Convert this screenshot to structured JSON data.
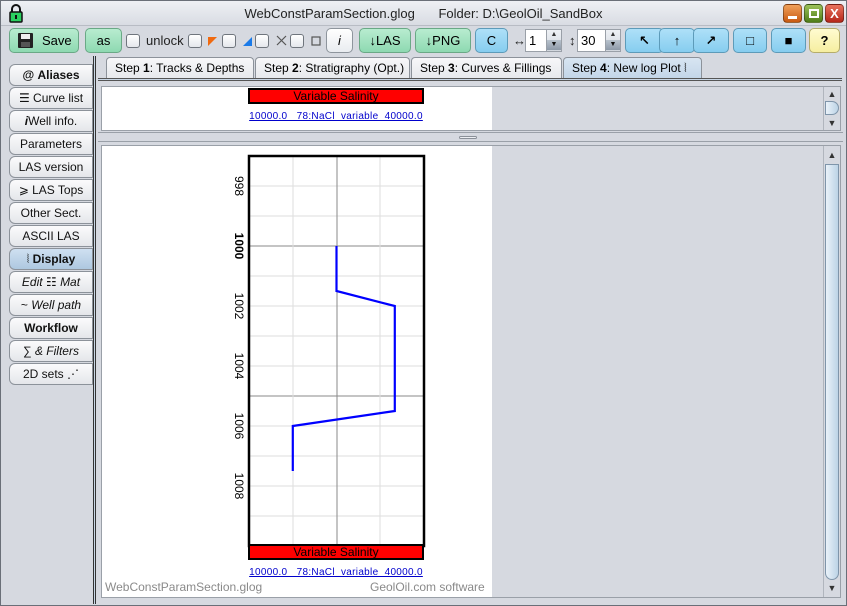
{
  "window": {
    "title": "WebConstParamSection.glog",
    "folder": "Folder: D:\\GeolOil_SandBox",
    "controls": {
      "minimize": "_",
      "maximize": "□",
      "close": "X"
    }
  },
  "toolbar": {
    "save": "Save",
    "save_as": "as",
    "unlock": "unlock",
    "info": "i",
    "export_las": "↓LAS",
    "export_png": "↓PNG",
    "c": "C",
    "width_symbol": "↔",
    "width_value": "1",
    "height_symbol": "↕",
    "height_value": "30",
    "arrow_up_left": "↖",
    "arrow_up": "↑",
    "arrow_up_right": "↗",
    "square_outline": "□",
    "square_filled": "■",
    "help": "?"
  },
  "sidebar": {
    "items": [
      {
        "icon": "@",
        "label": "Aliases",
        "active": false
      },
      {
        "icon": "☰",
        "label": "Curve list",
        "active": false
      },
      {
        "icon": "i",
        "label": "Well info.",
        "active": false
      },
      {
        "icon": "",
        "label": "Parameters",
        "active": false
      },
      {
        "icon": "",
        "label": "LAS version",
        "active": false
      },
      {
        "icon": "⩾",
        "label": "LAS Tops",
        "active": false
      },
      {
        "icon": "",
        "label": "Other Sect.",
        "active": false
      },
      {
        "icon": "",
        "label": "ASCII LAS",
        "active": false
      },
      {
        "icon": "⦚",
        "label": "Display",
        "active": true
      },
      {
        "icon": "☷",
        "label": "Edit",
        "label2": "Mat",
        "active": false
      },
      {
        "icon": "~",
        "label": "Well path",
        "active": false
      },
      {
        "icon": "",
        "label": "Workflow",
        "active": false
      },
      {
        "icon": "∑",
        "label": "& Filters",
        "active": false
      },
      {
        "icon": "⋰",
        "label": "2D sets",
        "active": false
      }
    ]
  },
  "tabs": [
    {
      "prefix": "Step ",
      "num": "1",
      "label": ": Tracks & Depths",
      "active": false
    },
    {
      "prefix": "Step ",
      "num": "2",
      "label": ": Stratigraphy (Opt.)",
      "active": false
    },
    {
      "prefix": "Step ",
      "num": "3",
      "label": ": Curves & Fillings",
      "active": false
    },
    {
      "prefix": "Step ",
      "num": "4",
      "label": ": New log Plot ⦚",
      "active": true
    }
  ],
  "plot": {
    "curve_title": "Variable Salinity",
    "curve_scale_text": "10000.0   78:NaCl  variable  40000.0",
    "footer_file": "WebConstParamSection.glog",
    "footer_brand": "GeolOil.com software"
  },
  "chart_data": {
    "type": "line",
    "title": "Variable Salinity",
    "curve_mnemonic": "78:NaCl variable",
    "x_range": [
      10000,
      40000
    ],
    "y_range": [
      997,
      1010
    ],
    "y_inverted": true,
    "y_ticks": [
      998,
      1000,
      1002,
      1004,
      1006,
      1008
    ],
    "y_tick_bold": [
      1000
    ],
    "x_gridlines": [
      17500,
      25000,
      32500
    ],
    "grid": true,
    "color": "#0000ff",
    "points": [
      {
        "x": 25000,
        "depth": 1000
      },
      {
        "x": 25000,
        "depth": 1001.5
      },
      {
        "x": 35000,
        "depth": 1002
      },
      {
        "x": 35000,
        "depth": 1005.5
      },
      {
        "x": 17500,
        "depth": 1006
      },
      {
        "x": 17500,
        "depth": 1007.5
      }
    ]
  }
}
